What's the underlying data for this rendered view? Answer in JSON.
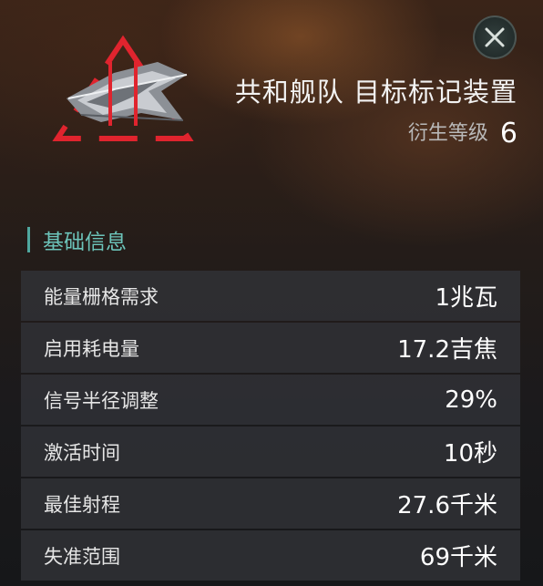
{
  "item": {
    "title": "共和舰队 目标标记装置",
    "meta_label": "衍生等级",
    "meta_value": "6",
    "icon_name": "target-marker-ship-icon"
  },
  "close_icon": "close-icon",
  "section": {
    "title": "基础信息"
  },
  "attributes": [
    {
      "name": "能量栅格需求",
      "value": "1兆瓦"
    },
    {
      "name": "启用耗电量",
      "value": "17.2吉焦"
    },
    {
      "name": "信号半径调整",
      "value": "29%"
    },
    {
      "name": "激活时间",
      "value": "10秒"
    },
    {
      "name": "最佳射程",
      "value": "27.6千米"
    },
    {
      "name": "失准范围",
      "value": "69千米"
    }
  ],
  "colors": {
    "accent": "#6cc4ba",
    "marker_red": "#e0242e"
  }
}
